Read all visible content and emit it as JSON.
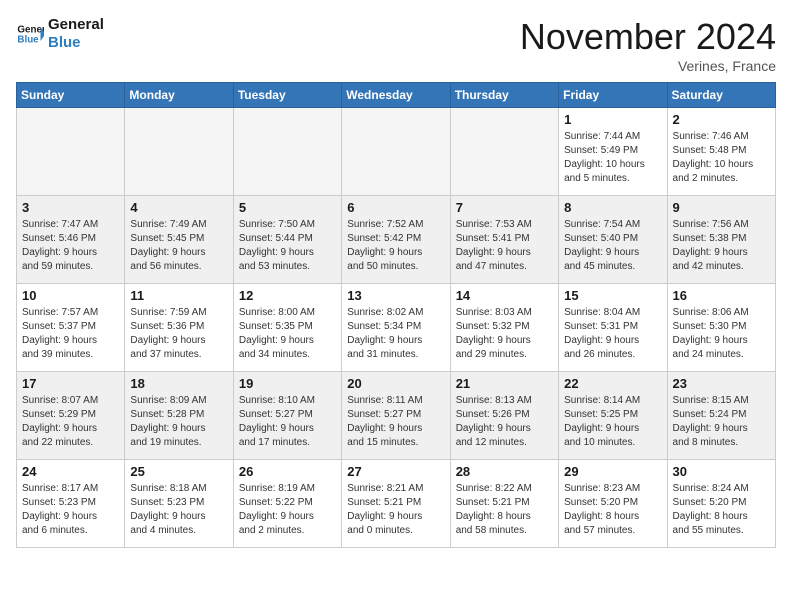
{
  "logo": {
    "line1": "General",
    "line2": "Blue"
  },
  "title": "November 2024",
  "location": "Verines, France",
  "header_days": [
    "Sunday",
    "Monday",
    "Tuesday",
    "Wednesday",
    "Thursday",
    "Friday",
    "Saturday"
  ],
  "weeks": [
    [
      {
        "day": "",
        "info": ""
      },
      {
        "day": "",
        "info": ""
      },
      {
        "day": "",
        "info": ""
      },
      {
        "day": "",
        "info": ""
      },
      {
        "day": "",
        "info": ""
      },
      {
        "day": "1",
        "info": "Sunrise: 7:44 AM\nSunset: 5:49 PM\nDaylight: 10 hours\nand 5 minutes."
      },
      {
        "day": "2",
        "info": "Sunrise: 7:46 AM\nSunset: 5:48 PM\nDaylight: 10 hours\nand 2 minutes."
      }
    ],
    [
      {
        "day": "3",
        "info": "Sunrise: 7:47 AM\nSunset: 5:46 PM\nDaylight: 9 hours\nand 59 minutes."
      },
      {
        "day": "4",
        "info": "Sunrise: 7:49 AM\nSunset: 5:45 PM\nDaylight: 9 hours\nand 56 minutes."
      },
      {
        "day": "5",
        "info": "Sunrise: 7:50 AM\nSunset: 5:44 PM\nDaylight: 9 hours\nand 53 minutes."
      },
      {
        "day": "6",
        "info": "Sunrise: 7:52 AM\nSunset: 5:42 PM\nDaylight: 9 hours\nand 50 minutes."
      },
      {
        "day": "7",
        "info": "Sunrise: 7:53 AM\nSunset: 5:41 PM\nDaylight: 9 hours\nand 47 minutes."
      },
      {
        "day": "8",
        "info": "Sunrise: 7:54 AM\nSunset: 5:40 PM\nDaylight: 9 hours\nand 45 minutes."
      },
      {
        "day": "9",
        "info": "Sunrise: 7:56 AM\nSunset: 5:38 PM\nDaylight: 9 hours\nand 42 minutes."
      }
    ],
    [
      {
        "day": "10",
        "info": "Sunrise: 7:57 AM\nSunset: 5:37 PM\nDaylight: 9 hours\nand 39 minutes."
      },
      {
        "day": "11",
        "info": "Sunrise: 7:59 AM\nSunset: 5:36 PM\nDaylight: 9 hours\nand 37 minutes."
      },
      {
        "day": "12",
        "info": "Sunrise: 8:00 AM\nSunset: 5:35 PM\nDaylight: 9 hours\nand 34 minutes."
      },
      {
        "day": "13",
        "info": "Sunrise: 8:02 AM\nSunset: 5:34 PM\nDaylight: 9 hours\nand 31 minutes."
      },
      {
        "day": "14",
        "info": "Sunrise: 8:03 AM\nSunset: 5:32 PM\nDaylight: 9 hours\nand 29 minutes."
      },
      {
        "day": "15",
        "info": "Sunrise: 8:04 AM\nSunset: 5:31 PM\nDaylight: 9 hours\nand 26 minutes."
      },
      {
        "day": "16",
        "info": "Sunrise: 8:06 AM\nSunset: 5:30 PM\nDaylight: 9 hours\nand 24 minutes."
      }
    ],
    [
      {
        "day": "17",
        "info": "Sunrise: 8:07 AM\nSunset: 5:29 PM\nDaylight: 9 hours\nand 22 minutes."
      },
      {
        "day": "18",
        "info": "Sunrise: 8:09 AM\nSunset: 5:28 PM\nDaylight: 9 hours\nand 19 minutes."
      },
      {
        "day": "19",
        "info": "Sunrise: 8:10 AM\nSunset: 5:27 PM\nDaylight: 9 hours\nand 17 minutes."
      },
      {
        "day": "20",
        "info": "Sunrise: 8:11 AM\nSunset: 5:27 PM\nDaylight: 9 hours\nand 15 minutes."
      },
      {
        "day": "21",
        "info": "Sunrise: 8:13 AM\nSunset: 5:26 PM\nDaylight: 9 hours\nand 12 minutes."
      },
      {
        "day": "22",
        "info": "Sunrise: 8:14 AM\nSunset: 5:25 PM\nDaylight: 9 hours\nand 10 minutes."
      },
      {
        "day": "23",
        "info": "Sunrise: 8:15 AM\nSunset: 5:24 PM\nDaylight: 9 hours\nand 8 minutes."
      }
    ],
    [
      {
        "day": "24",
        "info": "Sunrise: 8:17 AM\nSunset: 5:23 PM\nDaylight: 9 hours\nand 6 minutes."
      },
      {
        "day": "25",
        "info": "Sunrise: 8:18 AM\nSunset: 5:23 PM\nDaylight: 9 hours\nand 4 minutes."
      },
      {
        "day": "26",
        "info": "Sunrise: 8:19 AM\nSunset: 5:22 PM\nDaylight: 9 hours\nand 2 minutes."
      },
      {
        "day": "27",
        "info": "Sunrise: 8:21 AM\nSunset: 5:21 PM\nDaylight: 9 hours\nand 0 minutes."
      },
      {
        "day": "28",
        "info": "Sunrise: 8:22 AM\nSunset: 5:21 PM\nDaylight: 8 hours\nand 58 minutes."
      },
      {
        "day": "29",
        "info": "Sunrise: 8:23 AM\nSunset: 5:20 PM\nDaylight: 8 hours\nand 57 minutes."
      },
      {
        "day": "30",
        "info": "Sunrise: 8:24 AM\nSunset: 5:20 PM\nDaylight: 8 hours\nand 55 minutes."
      }
    ]
  ]
}
